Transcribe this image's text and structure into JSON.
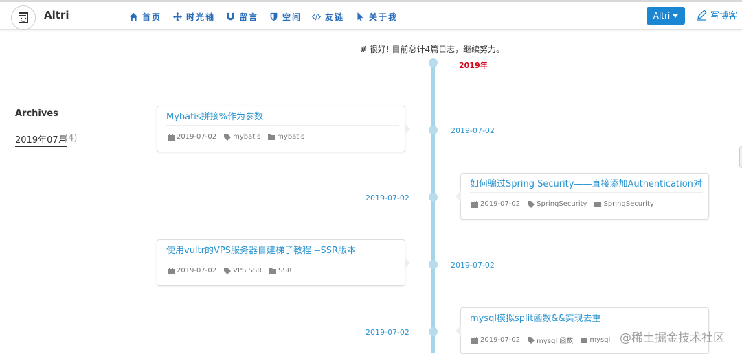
{
  "navbar": {
    "brand": "Altri",
    "items": [
      {
        "label": "首页",
        "icon": "home-icon"
      },
      {
        "label": "时光轴",
        "icon": "move-icon"
      },
      {
        "label": "留言",
        "icon": "magnet-icon"
      },
      {
        "label": "空间",
        "icon": "shield-icon"
      },
      {
        "label": "友链",
        "icon": "code-icon"
      },
      {
        "label": "关于我",
        "icon": "cursor-icon"
      }
    ],
    "user_button": "Altri",
    "write_label": "写博客"
  },
  "sidebar": {
    "title": "Archives",
    "archive_link": "2019年07月",
    "archive_count": "(4)"
  },
  "summary": "# 很好! 目前总计4篇日志，继续努力。",
  "timeline": {
    "year": "2019年",
    "entries": [
      {
        "side": "left",
        "date": "2019-07-02",
        "title": "Mybatis拼接%作为参数",
        "meta_date": "2019-07-02",
        "tags": "mybatis",
        "category": "mybatis"
      },
      {
        "side": "right",
        "date": "2019-07-02",
        "title": "如何骗过Spring Security——直接添加Authentication对象",
        "meta_date": "2019-07-02",
        "tags": "SpringSecurity",
        "category": "SpringSecurity"
      },
      {
        "side": "left",
        "date": "2019-07-02",
        "title": "使用vultr的VPS服务器自建梯子教程 --SSR版本",
        "meta_date": "2019-07-02",
        "tags": "VPS  SSR",
        "category": "SSR"
      },
      {
        "side": "right",
        "date": "2019-07-02",
        "title": "mysql模拟split函数&&实现去重",
        "meta_date": "2019-07-02",
        "tags": "mysql  函数",
        "category": "mysql"
      }
    ]
  },
  "watermark": "@稀土掘金技术社区",
  "colors": {
    "accent": "#1b86d1",
    "link": "#2a94d0",
    "year": "#d0021b",
    "timeline": "#a6d4e8"
  }
}
